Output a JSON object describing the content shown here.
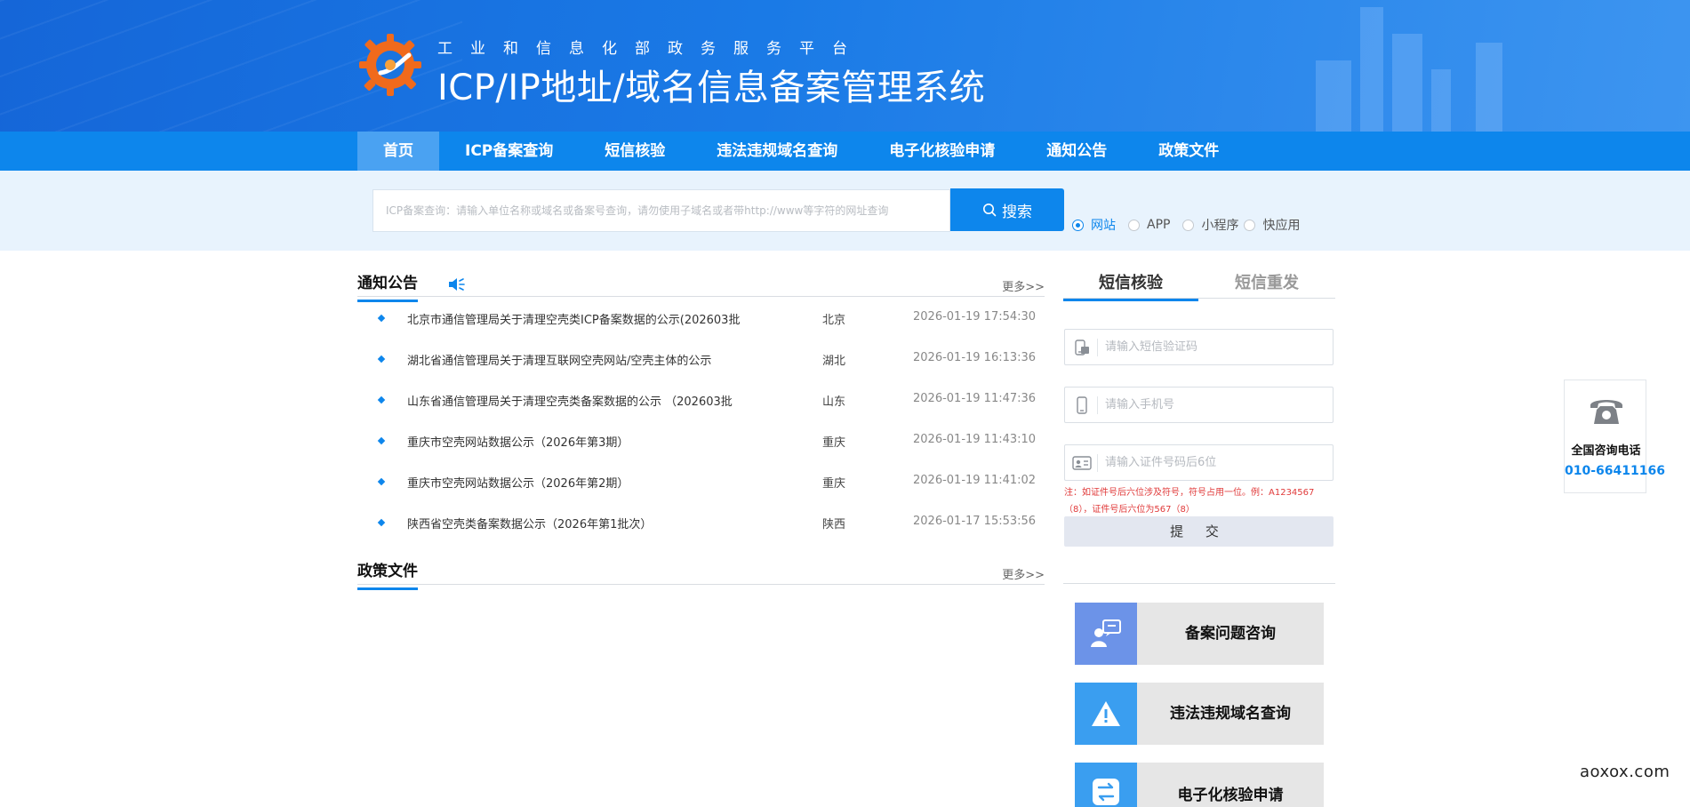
{
  "header": {
    "subtitle": "工业和信息化部政务服务平台",
    "title": "ICP/IP地址/域名信息备案管理系统"
  },
  "nav": {
    "items": [
      "首页",
      "ICP备案查询",
      "短信核验",
      "违法违规域名查询",
      "电子化核验申请",
      "通知公告",
      "政策文件"
    ],
    "active_index": 0
  },
  "search": {
    "placeholder": "ICP备案查询：请输入单位名称或域名或备案号查询，请勿使用子域名或者带http://www等字符的网址查询",
    "button_label": "搜索",
    "types": [
      "网站",
      "APP",
      "小程序",
      "快应用"
    ],
    "selected_type": "网站"
  },
  "notices": {
    "title": "通知公告",
    "more": "更多>>",
    "items": [
      {
        "title": "北京市通信管理局关于清理空壳类ICP备案数据的公示(202603批",
        "region": "北京",
        "datetime": "2026-01-19 17:54:30"
      },
      {
        "title": "湖北省通信管理局关于清理互联网空壳网站/空壳主体的公示",
        "region": "湖北",
        "datetime": "2026-01-19 16:13:36"
      },
      {
        "title": "山东省通信管理局关于清理空壳类备案数据的公示 （202603批",
        "region": "山东",
        "datetime": "2026-01-19 11:47:36"
      },
      {
        "title": "重庆市空壳网站数据公示（2026年第3期）",
        "region": "重庆",
        "datetime": "2026-01-19 11:43:10"
      },
      {
        "title": "重庆市空壳网站数据公示（2026年第2期）",
        "region": "重庆",
        "datetime": "2026-01-19 11:41:02"
      },
      {
        "title": "陕西省空壳类备案数据公示（2026年第1批次）",
        "region": "陕西",
        "datetime": "2026-01-17 15:53:56"
      }
    ]
  },
  "policy": {
    "title": "政策文件",
    "more": "更多>>"
  },
  "sms": {
    "tab_active": "短信核验",
    "tab_other": "短信重发",
    "code_placeholder": "请输入短信验证码",
    "phone_placeholder": "请输入手机号",
    "id_placeholder": "请输入证件号码后6位",
    "note": "注：如证件号后六位涉及符号，符号占用一位。例：A1234567（8），证件号后六位为567（8）",
    "submit_label": "提 交"
  },
  "quick_links": [
    {
      "label": "备案问题咨询",
      "icon": "consult-icon",
      "color": "#6c93e8"
    },
    {
      "label": "违法违规域名查询",
      "icon": "warning-icon",
      "color": "#3a9ef0"
    },
    {
      "label": "电子化核验申请",
      "icon": "exchange-icon",
      "color": "#3a9ef0"
    }
  ],
  "hotline": {
    "label": "全国咨询电话",
    "number": "010-66411166"
  },
  "watermark": "aoxox.com",
  "colors": {
    "primary": "#0d86ec",
    "header": "#1a7ae6",
    "nav_active": "#4aa2f2",
    "note_red": "#e03a3a"
  }
}
